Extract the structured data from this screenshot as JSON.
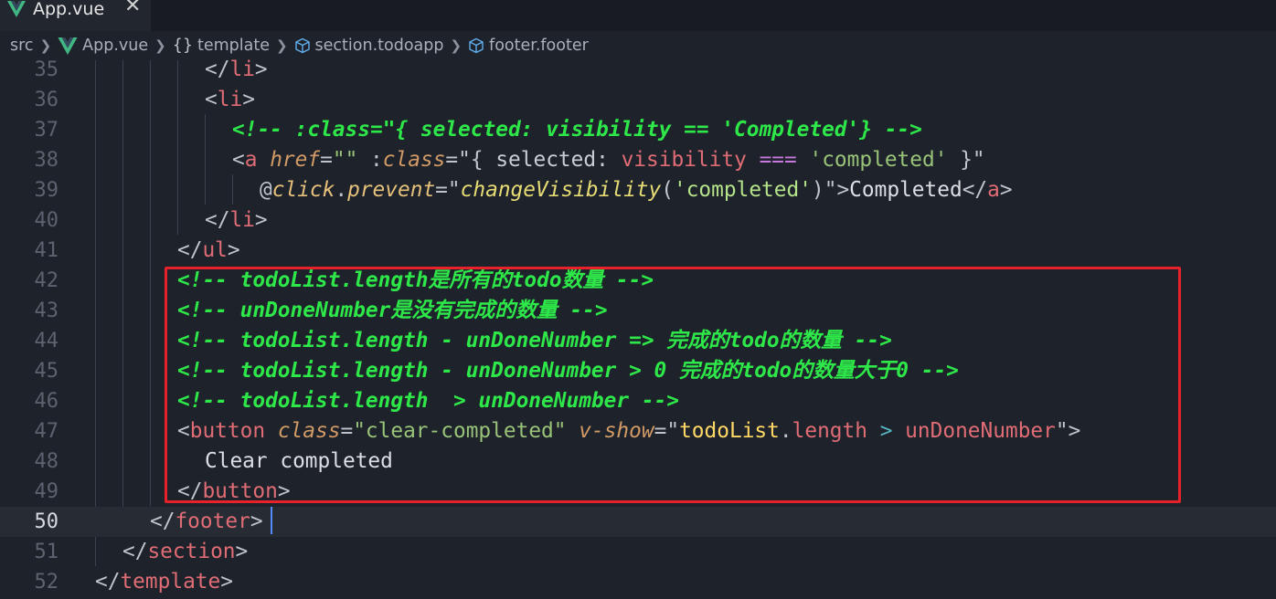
{
  "tab": {
    "label": "App.vue",
    "close": "✕"
  },
  "breadcrumb": {
    "src": "src",
    "file": "App.vue",
    "braces": "{}",
    "template": "template",
    "section": "section.todoapp",
    "footer": "footer.footer"
  },
  "lines": {
    "l35": {
      "n": "35",
      "a": "</",
      "b": "li",
      "c": ">"
    },
    "l36": {
      "n": "36",
      "a": "<",
      "b": "li",
      "c": ">"
    },
    "l37": {
      "n": "37",
      "text": "<!-- :class=\"{ selected: visibility == 'Completed'} -->"
    },
    "l38": {
      "n": "38",
      "lt": "<",
      "tag": "a",
      "href": "href",
      "eq1": "=",
      "hv": "\"\"",
      "colon": ":",
      "cls": "class",
      "eq2": "=",
      "q1": "\"",
      "ob": "{ ",
      "sel": "selected:",
      "vis": "visibility",
      "op": "===",
      "val": "'completed'",
      "cb": " }",
      "q2": "\""
    },
    "l39": {
      "n": "39",
      "at": "@",
      "click": "click",
      "dot": ".",
      "prevent": "prevent",
      "eq": "=",
      "q1": "\"",
      "fn": "changeVisibility",
      "po": "(",
      "arg": "'completed'",
      "pc": ")",
      "q2": "\"",
      "gt": ">",
      "txt": "Completed",
      "close1": "</",
      "ctag": "a",
      "close2": ">"
    },
    "l40": {
      "n": "40",
      "a": "</",
      "b": "li",
      "c": ">"
    },
    "l41": {
      "n": "41",
      "a": "</",
      "b": "ul",
      "c": ">"
    },
    "l42": {
      "n": "42",
      "text": "<!-- todoList.length是所有的todo数量 -->"
    },
    "l43": {
      "n": "43",
      "text": "<!-- unDoneNumber是没有完成的数量 -->"
    },
    "l44": {
      "n": "44",
      "text": "<!-- todoList.length - unDoneNumber => 完成的todo的数量 -->"
    },
    "l45": {
      "n": "45",
      "text": "<!-- todoList.length - unDoneNumber > 0 完成的todo的数量大于0 -->"
    },
    "l46": {
      "n": "46",
      "text": "<!-- todoList.length  > unDoneNumber -->"
    },
    "l47": {
      "n": "47",
      "lt": "<",
      "tag": "button",
      "cls": "class",
      "eq1": "=",
      "clsv": "\"clear-completed\"",
      "vshow": "v-show",
      "eq2": "=",
      "q1": "\"",
      "obj": "todoList",
      "dot": ".",
      "len": "length",
      "gt": " > ",
      "und": "unDoneNumber",
      "q2": "\"",
      "end": ">"
    },
    "l48": {
      "n": "48",
      "text": "Clear completed"
    },
    "l49": {
      "n": "49",
      "a": "</",
      "b": "button",
      "c": ">"
    },
    "l50": {
      "n": "50",
      "a": "</",
      "b": "footer",
      "c": ">"
    },
    "l51": {
      "n": "51",
      "a": "</",
      "b": "section",
      "c": ">"
    },
    "l52": {
      "n": "52",
      "a": "</",
      "b": "template",
      "c": ">"
    }
  },
  "colors": {
    "background": "#1e222a",
    "comment": "#2ee84a",
    "tag": "#e06c75",
    "highlight_box": "#e8212a",
    "cursor": "#528bff"
  },
  "icons": {
    "tab": "vue-logo-icon",
    "breadcrumb_file": "vue-logo-icon",
    "section": "cube-icon",
    "footer": "cube-icon"
  }
}
